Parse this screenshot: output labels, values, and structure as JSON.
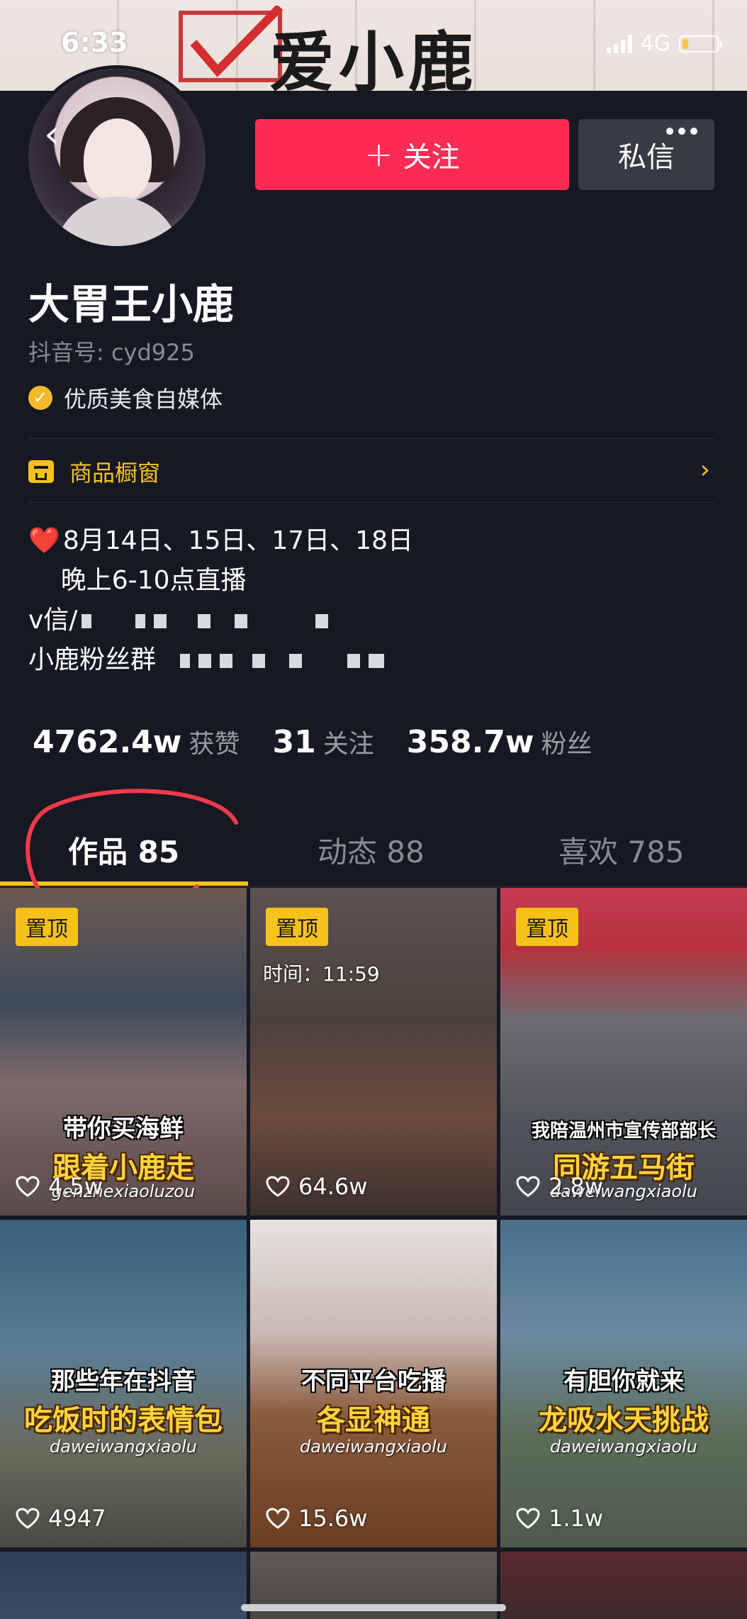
{
  "status_bar": {
    "time": "6:33",
    "network": "4G"
  },
  "banner": {
    "title": "爱小鹿"
  },
  "profile": {
    "follow_label": "关注",
    "message_label": "私信",
    "name": "大胃王小鹿",
    "douyin_id": "抖音号: cyd925",
    "verified_label": "优质美食自媒体",
    "shop_label": "商品橱窗"
  },
  "bio": {
    "line1": "8月14日、15日、17日、18日",
    "line2": "    晚上6-10点直播",
    "line3": "v信/",
    "line4": "小鹿粉丝群"
  },
  "stats": [
    {
      "value": "4762.4w",
      "label": "获赞"
    },
    {
      "value": "31",
      "label": "关注"
    },
    {
      "value": "358.7w",
      "label": "粉丝"
    }
  ],
  "tabs": [
    {
      "label": "作品 85",
      "active": true
    },
    {
      "label": "动态 88",
      "active": false
    },
    {
      "label": "喜欢 785",
      "active": false
    }
  ],
  "videos": [
    {
      "pinned": "置顶",
      "caption1": "带你买海鲜",
      "caption2": "跟着小鹿走",
      "caption3": "genzhexiaoluzou",
      "likes": "4.5w"
    },
    {
      "pinned": "置顶",
      "time_tag": "时间：11:59",
      "likes": "64.6w"
    },
    {
      "pinned": "置顶",
      "caption1": "我陪温州市宣传部部长",
      "caption2": "同游五马街",
      "caption3": "daweiwangxiaolu",
      "likes": "2.8w"
    },
    {
      "caption1": "那些年在抖音",
      "caption2": "吃饭时的表情包",
      "caption3": "daweiwangxiaolu",
      "likes": "4947"
    },
    {
      "caption1": "不同平台吃播",
      "caption2": "各显神通",
      "caption3": "daweiwangxiaolu",
      "likes": "15.6w"
    },
    {
      "caption1": "有胆你就来",
      "caption2": "龙吸水天挑战",
      "caption3": "daweiwangxiaolu",
      "likes": "1.1w"
    }
  ],
  "colors": {
    "background": "#161823",
    "accent_red": "#fe2c55",
    "accent_yellow": "#f6c21a"
  }
}
